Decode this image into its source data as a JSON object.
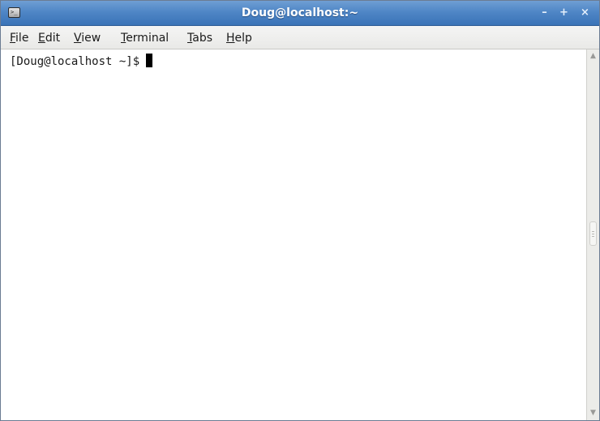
{
  "window": {
    "title": "Doug@localhost:~",
    "icon": "terminal-icon",
    "controls": {
      "minimize": "minimize-icon",
      "maximize": "maximize-icon",
      "close": "close-icon"
    }
  },
  "menubar": {
    "items": [
      {
        "mnemonic": "F",
        "rest": "ile"
      },
      {
        "mnemonic": "E",
        "rest": "dit"
      },
      {
        "mnemonic": "V",
        "rest": "iew"
      },
      {
        "mnemonic": "T",
        "rest": "erminal"
      },
      {
        "mnemonic": "T",
        "rest": "abs"
      },
      {
        "mnemonic": "H",
        "rest": "elp"
      }
    ]
  },
  "terminal": {
    "prompt": "[Doug@localhost ~]$"
  },
  "colors": {
    "titlebar": "#4f86c6",
    "title_text": "#ffffff",
    "menubar": "#efefed",
    "terminal_bg": "#ffffff",
    "text": "#1a1a1a"
  }
}
